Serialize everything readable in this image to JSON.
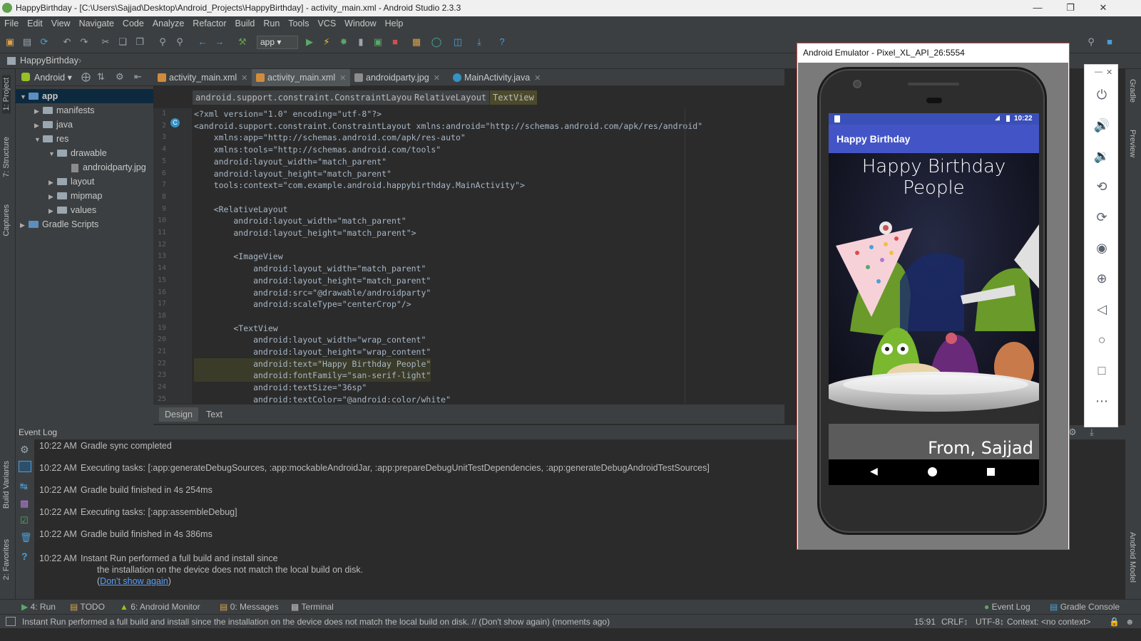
{
  "window": {
    "title": "HappyBirthday - [C:\\Users\\Sajjad\\Desktop\\Android_Projects\\HappyBirthday] - activity_main.xml - Android Studio 2.3.3"
  },
  "menu": [
    "File",
    "Edit",
    "View",
    "Navigate",
    "Code",
    "Analyze",
    "Refactor",
    "Build",
    "Run",
    "Tools",
    "VCS",
    "Window",
    "Help"
  ],
  "toolbar": {
    "run_config": "app"
  },
  "navbar": {
    "project": "HappyBirthday"
  },
  "project_panel": {
    "view": "Android",
    "tree": [
      {
        "label": "app",
        "level": 0,
        "expanded": true,
        "selected": true
      },
      {
        "label": "manifests",
        "level": 1,
        "expanded": false
      },
      {
        "label": "java",
        "level": 1,
        "expanded": false
      },
      {
        "label": "res",
        "level": 1,
        "expanded": true
      },
      {
        "label": "drawable",
        "level": 2,
        "expanded": true
      },
      {
        "label": "androidparty.jpg",
        "level": 3,
        "file": true
      },
      {
        "label": "layout",
        "level": 2,
        "expanded": false
      },
      {
        "label": "mipmap",
        "level": 2,
        "expanded": false
      },
      {
        "label": "values",
        "level": 2,
        "expanded": false
      },
      {
        "label": "Gradle Scripts",
        "level": 0,
        "expanded": false
      }
    ]
  },
  "left_strip": {
    "project": "1: Project",
    "structure": "7: Structure",
    "captures": "Captures",
    "build_variants": "Build Variants",
    "favorites": "2: Favorites"
  },
  "right_strip": {
    "gradle": "Gradle",
    "preview": "Preview",
    "android_model": "Android Model"
  },
  "tabs": [
    {
      "label": "activity_main.xml",
      "active": false,
      "color": "#d08c3c"
    },
    {
      "label": "activity_main.xml",
      "active": true,
      "color": "#d08c3c"
    },
    {
      "label": "androidparty.jpg",
      "active": false,
      "color": "#8c8c8c"
    },
    {
      "label": "MainActivity.java",
      "active": false,
      "color": "#3592c4"
    }
  ],
  "breadcrumbs": [
    "android.support.constraint.ConstraintLayout",
    "RelativeLayout",
    "TextView"
  ],
  "code_lines": [
    {
      "n": "1",
      "text": "<?xml version=\"1.0\" encoding=\"utf-8\"?>"
    },
    {
      "n": "2",
      "text": "<android.support.constraint.ConstraintLayout xmlns:android=\"http://schemas.android.com/apk/res/android\""
    },
    {
      "n": "3",
      "text": "    xmlns:app=\"http://schemas.android.com/apk/res-auto\""
    },
    {
      "n": "4",
      "text": "    xmlns:tools=\"http://schemas.android.com/tools\""
    },
    {
      "n": "5",
      "text": "    android:layout_width=\"match_parent\""
    },
    {
      "n": "6",
      "text": "    android:layout_height=\"match_parent\""
    },
    {
      "n": "7",
      "text": "    tools:context=\"com.example.android.happybirthday.MainActivity\">"
    },
    {
      "n": "8",
      "text": ""
    },
    {
      "n": "9",
      "text": "    <RelativeLayout"
    },
    {
      "n": "10",
      "text": "        android:layout_width=\"match_parent\""
    },
    {
      "n": "11",
      "text": "        android:layout_height=\"match_parent\">"
    },
    {
      "n": "12",
      "text": ""
    },
    {
      "n": "13",
      "text": "        <ImageView"
    },
    {
      "n": "14",
      "text": "            android:layout_width=\"match_parent\""
    },
    {
      "n": "15",
      "text": "            android:layout_height=\"match_parent\""
    },
    {
      "n": "16",
      "text": "            android:src=\"@drawable/androidparty\""
    },
    {
      "n": "17",
      "text": "            android:scaleType=\"centerCrop\"/>"
    },
    {
      "n": "18",
      "text": ""
    },
    {
      "n": "19",
      "text": "        <TextView"
    },
    {
      "n": "20",
      "text": "            android:layout_width=\"wrap_content\""
    },
    {
      "n": "21",
      "text": "            android:layout_height=\"wrap_content\""
    },
    {
      "n": "22",
      "text": "            android:text=\"Happy Birthday People\""
    },
    {
      "n": "23",
      "text": "            android:fontFamily=\"san-serif-light\""
    },
    {
      "n": "24",
      "text": "            android:textSize=\"36sp\""
    },
    {
      "n": "25",
      "text": "            android:textColor=\"@android:color/white\""
    }
  ],
  "editor_bottom_tabs": [
    "Design",
    "Text"
  ],
  "event_log": {
    "title": "Event Log",
    "entries": [
      {
        "time": "10:22 AM",
        "text": "Gradle sync completed"
      },
      {
        "time": "10:22 AM",
        "text": "Executing tasks: [:app:generateDebugSources, :app:mockableAndroidJar, :app:prepareDebugUnitTestDependencies, :app:generateDebugAndroidTestSources]"
      },
      {
        "time": "10:22 AM",
        "text": "Gradle build finished in 4s 254ms"
      },
      {
        "time": "10:22 AM",
        "text": "Executing tasks: [:app:assembleDebug]"
      },
      {
        "time": "10:22 AM",
        "text": "Gradle build finished in 4s 386ms"
      },
      {
        "time": "10:22 AM",
        "text": "Instant Run performed a full build and install since"
      }
    ],
    "continuation": "the installation on the device does not match the local build on disk.",
    "link_text": "Don't show again",
    "paren_open": "(",
    "paren_close": ")"
  },
  "bottom_tool_tabs": [
    "4: Run",
    "TODO",
    "6: Android Monitor",
    "0: Messages",
    "Terminal"
  ],
  "bottom_right_tabs": [
    "Event Log",
    "Gradle Console"
  ],
  "status": {
    "message": "Instant Run performed a full build and install since the installation on the device does not match the local build on disk. // (Don't show again) (moments ago)",
    "position": "15:91",
    "line_sep": "CRLF↕",
    "encoding": "UTF-8↕",
    "context": "Context: <no context>"
  },
  "emulator": {
    "title": "Android Emulator - Pixel_XL_API_26:5554",
    "time": "10:22",
    "app_title": "Happy Birthday",
    "headline": "Happy Birthday People",
    "signature": "From, Sajjad"
  },
  "colors": {
    "ide_bg": "#2b2b2b",
    "panel": "#3c3f41",
    "app_bar": "#4355c6",
    "emulator_border": "#d04a4a"
  }
}
